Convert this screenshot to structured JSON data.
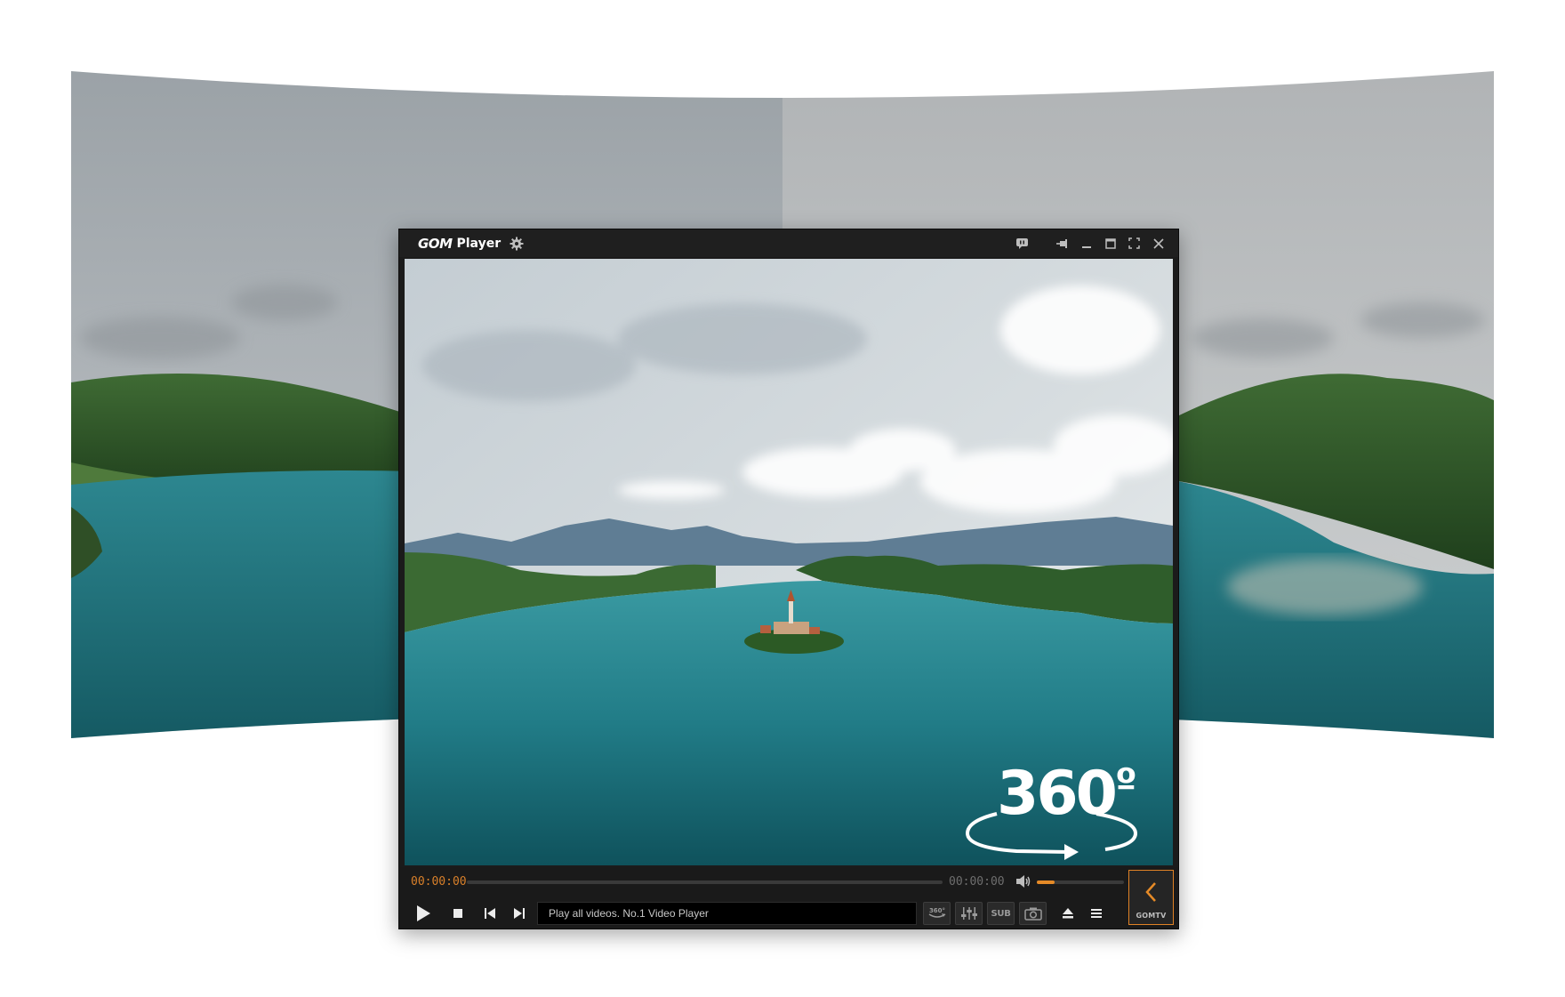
{
  "app": {
    "brand": "GOM",
    "product": "Player"
  },
  "playback": {
    "current_time": "00:00:00",
    "total_time": "00:00:00",
    "seek_progress": 0,
    "volume_level": 0.2,
    "marquee_text": "Play all videos. No.1 Video Player"
  },
  "video": {
    "overlay_text": "360",
    "overlay_degree": "º"
  },
  "toolbar": {
    "sub_label": "SUB",
    "gomtv_label": "GOMTV"
  },
  "colors": {
    "accent": "#e58a27",
    "time_current": "#d9802a",
    "titlebar": "#1f1f1f",
    "lake": "#1f7a85"
  },
  "icons": {
    "settings": "gear-icon",
    "chat": "chat-icon",
    "pin": "pin-icon",
    "minimize": "minimize-icon",
    "maximize": "maximize-icon",
    "fullscreen": "fullscreen-icon",
    "close": "close-icon",
    "play": "play-icon",
    "stop": "stop-icon",
    "previous": "skip-previous-icon",
    "next": "skip-next-icon",
    "volume": "speaker-icon",
    "vr360": "vr360-icon",
    "equalizer": "equalizer-icon",
    "capture": "camera-icon",
    "eject": "eject-icon",
    "menu": "hamburger-menu-icon",
    "gomtv": "chevron-left-icon"
  }
}
